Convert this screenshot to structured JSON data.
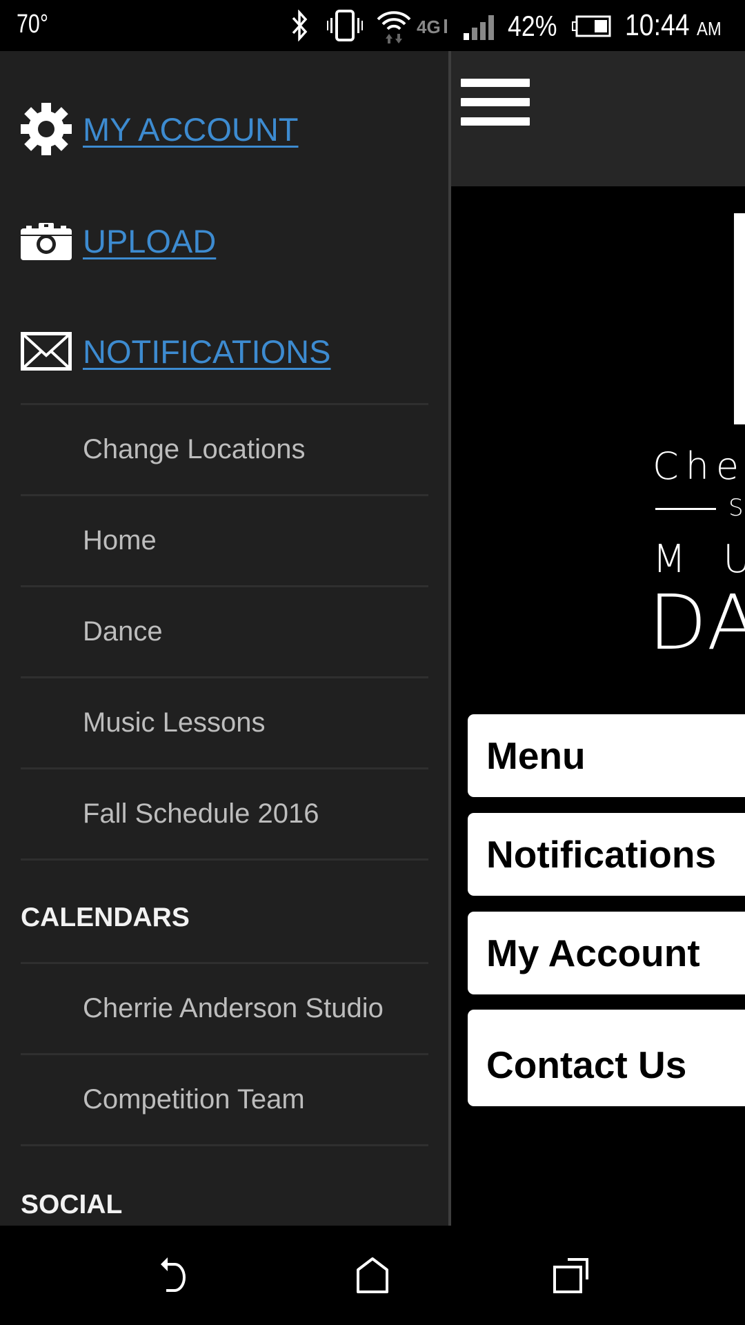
{
  "status_bar": {
    "temperature": "70°",
    "icons": [
      "bluetooth-icon",
      "vibrate-icon",
      "wifi-icon",
      "4g-lte-icon",
      "signal-icon",
      "battery-icon"
    ],
    "battery_percent": "42%",
    "time": "10:44",
    "ampm": "AM"
  },
  "drawer": {
    "top_links": [
      {
        "label": "MY ACCOUNT",
        "icon": "gear-icon"
      },
      {
        "label": "UPLOAD",
        "icon": "camera-icon"
      },
      {
        "label": "NOTIFICATIONS",
        "icon": "envelope-icon"
      }
    ],
    "items": [
      {
        "label": "Change Locations"
      },
      {
        "label": "Home"
      },
      {
        "label": "Dance"
      },
      {
        "label": "Music Lessons"
      },
      {
        "label": "Fall Schedule 2016"
      }
    ],
    "sections": [
      {
        "title": "CALENDARS",
        "items": [
          {
            "label": "Cherrie Anderson Studio"
          },
          {
            "label": "Competition Team"
          }
        ]
      },
      {
        "title": "SOCIAL",
        "items": []
      }
    ],
    "link_color": "#3d8bd0"
  },
  "main": {
    "menu_icon": "hamburger-icon",
    "logo": {
      "line1": "Cher",
      "line2": "S",
      "line3": "M U",
      "line4": "DA"
    },
    "cards": [
      {
        "label": "Menu"
      },
      {
        "label": "Notifications"
      },
      {
        "label": "My Account"
      },
      {
        "label": "Contact Us"
      }
    ]
  },
  "nav_bar": {
    "buttons": [
      "back-icon",
      "home-icon",
      "recents-icon"
    ]
  }
}
